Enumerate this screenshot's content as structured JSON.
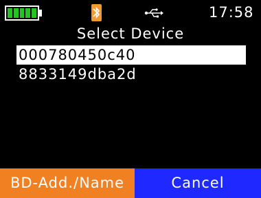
{
  "status_bar": {
    "battery_level": 1.0,
    "battery_color": "#22c522",
    "bluetooth_icon": "bluetooth-icon",
    "bluetooth_color": "#f39a2d",
    "usb_icon": "usb-icon",
    "time": "17:58"
  },
  "header": {
    "title": "Select Device"
  },
  "devices": [
    {
      "label": "000780450c40",
      "selected": true
    },
    {
      "label": "8833149dba2d",
      "selected": false
    }
  ],
  "softkeys": {
    "left_label": "BD-Add./Name",
    "left_color": "#f08022",
    "right_label": "Cancel",
    "right_color": "#1f29ff"
  }
}
